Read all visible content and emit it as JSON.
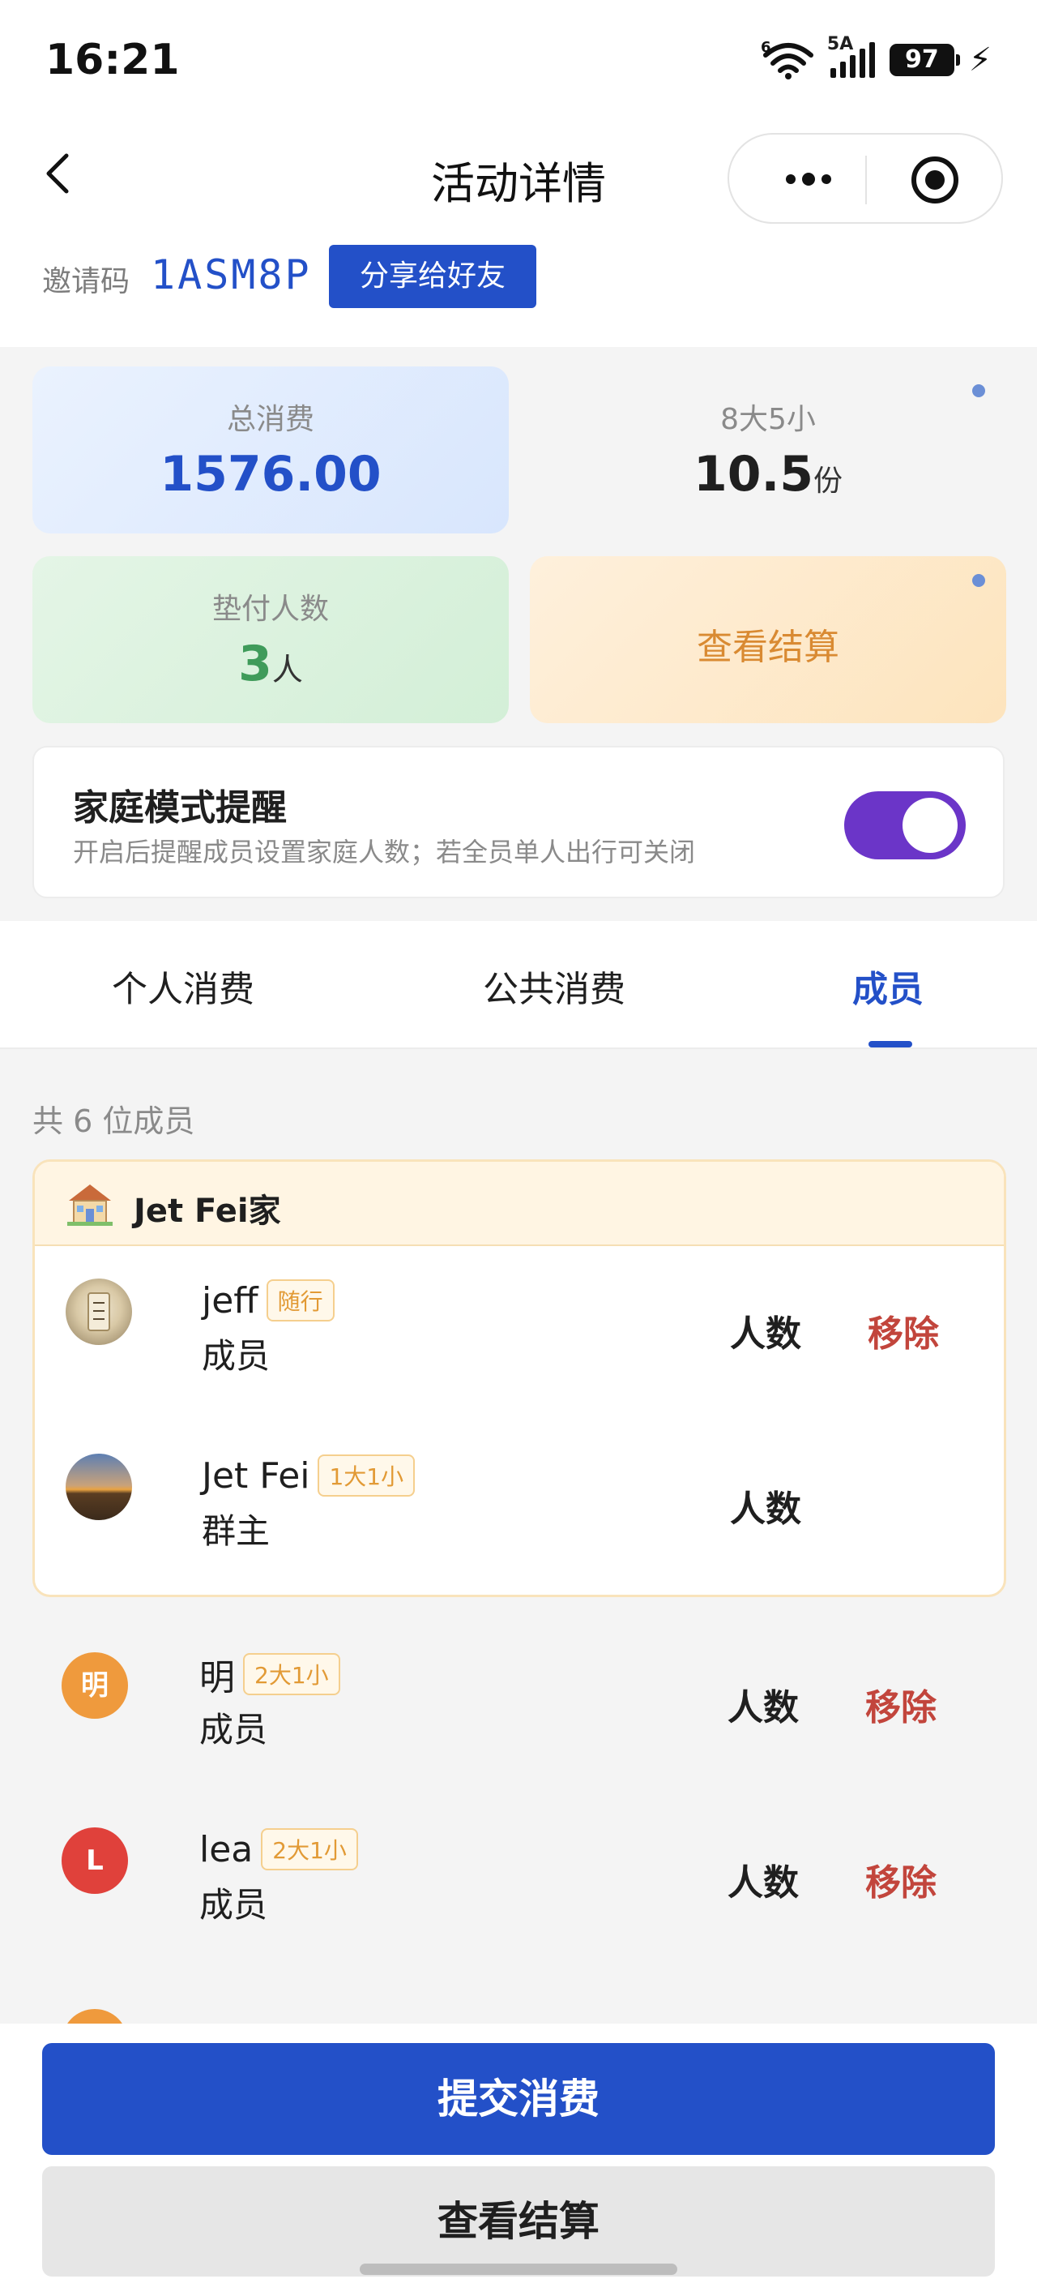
{
  "status_bar": {
    "time": "16:21",
    "network_label": "5A",
    "wifi_label": "6",
    "battery": "97",
    "icons": [
      "wifi-icon",
      "signal-icon",
      "battery-icon",
      "charging-icon"
    ]
  },
  "nav": {
    "title": "活动详情",
    "back_icon": "chevron-left-icon",
    "more_icon": "more-dots-icon",
    "close_icon": "target-icon"
  },
  "invite": {
    "label": "邀请码",
    "code": "1ASM8P",
    "share_label": "分享给好友"
  },
  "stats": {
    "total": {
      "label": "总消费",
      "value": "1576.00"
    },
    "shares": {
      "label": "8大5小",
      "value": "10.5",
      "unit": "份"
    },
    "payers": {
      "label": "垫付人数",
      "value": "3",
      "unit": "人"
    },
    "settlement": {
      "label": "查看结算"
    }
  },
  "family_mode": {
    "title": "家庭模式提醒",
    "description": "开启后提醒成员设置家庭人数；若全员单人出行可关闭",
    "enabled": true
  },
  "tabs": [
    {
      "label": "个人消费",
      "active": false
    },
    {
      "label": "公共消费",
      "active": false
    },
    {
      "label": "成员",
      "active": true
    }
  ],
  "members_summary": "共 6 位成员",
  "family_group": {
    "title": "Jet Fei家",
    "icon": "house-icon",
    "members": [
      {
        "name": "jeff",
        "tag": "随行",
        "role": "成员",
        "headcount_label": "人数",
        "remove_label": "移除"
      },
      {
        "name": "Jet Fei",
        "tag": "1大1小",
        "role": "群主",
        "headcount_label": "人数",
        "remove_label": ""
      }
    ]
  },
  "other_members": [
    {
      "avatar_text": "明",
      "avatar_color": "#ef9a3d",
      "name": "明",
      "tag": "2大1小",
      "role": "成员",
      "headcount_label": "人数",
      "remove_label": "移除"
    },
    {
      "avatar_text": "L",
      "avatar_color": "#e0413b",
      "name": "lea",
      "tag": "2大1小",
      "role": "成员",
      "headcount_label": "人数",
      "remove_label": "移除"
    }
  ],
  "actions": {
    "submit_label": "提交消费",
    "settle_label": "查看结算"
  },
  "colors": {
    "primary": "#2350c8",
    "toggle": "#6b35c8",
    "remove": "#c2453c",
    "tag": "#e29a35"
  }
}
